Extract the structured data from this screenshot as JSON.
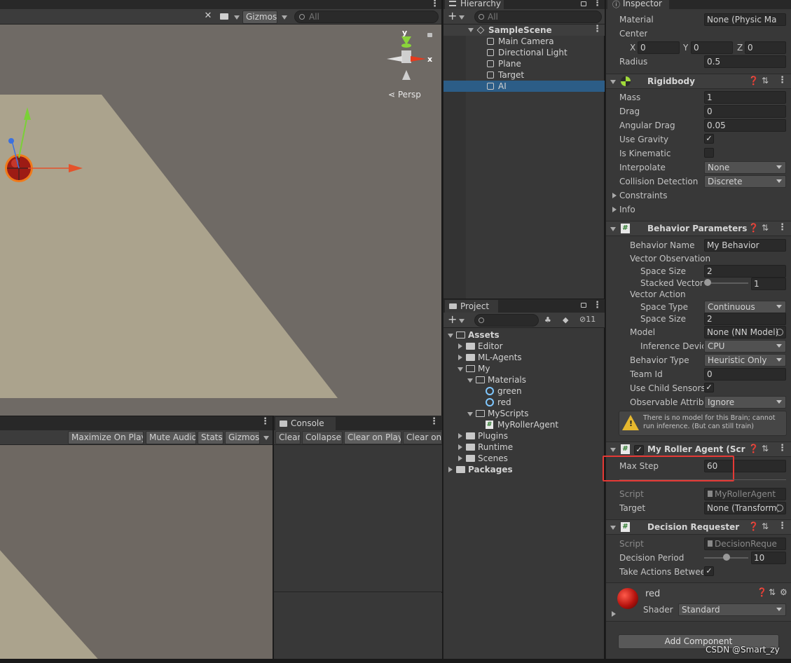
{
  "scene": {
    "toolbar": {
      "gizmos_label": "Gizmos",
      "search_placeholder": "All"
    },
    "gizmo": {
      "y_label": "y",
      "x_label": "x",
      "persp_label": "Persp"
    }
  },
  "game": {
    "toolbar": [
      "Maximize On Play",
      "Mute Audio",
      "Stats",
      "Gizmos"
    ]
  },
  "console": {
    "tab_label": "Console",
    "toolbar": [
      "Clear",
      "Collapse",
      "Clear on Play",
      "Clear on"
    ]
  },
  "hierarchy": {
    "tab_label": "Hierarchy",
    "search_placeholder": "All",
    "scene_name": "SampleScene",
    "items": [
      "Main Camera",
      "Directional Light",
      "Plane",
      "Target",
      "AI"
    ],
    "selected": "AI"
  },
  "project": {
    "tab_label": "Project",
    "hidden_count": "11",
    "tree": [
      {
        "label": "Assets",
        "depth": 0,
        "expanded": true,
        "bold": true,
        "type": "folder"
      },
      {
        "label": "Editor",
        "depth": 1,
        "expanded": false,
        "type": "folder"
      },
      {
        "label": "ML-Agents",
        "depth": 1,
        "expanded": false,
        "type": "folder"
      },
      {
        "label": "My",
        "depth": 1,
        "expanded": true,
        "type": "folder"
      },
      {
        "label": "Materials",
        "depth": 2,
        "expanded": true,
        "type": "folder"
      },
      {
        "label": "green",
        "depth": 3,
        "type": "material"
      },
      {
        "label": "red",
        "depth": 3,
        "type": "material"
      },
      {
        "label": "MyScripts",
        "depth": 2,
        "expanded": true,
        "type": "folder"
      },
      {
        "label": "MyRollerAgent",
        "depth": 3,
        "type": "script"
      },
      {
        "label": "Plugins",
        "depth": 1,
        "expanded": false,
        "type": "folder"
      },
      {
        "label": "Runtime",
        "depth": 1,
        "expanded": false,
        "type": "folder"
      },
      {
        "label": "Scenes",
        "depth": 1,
        "expanded": false,
        "type": "folder"
      },
      {
        "label": "Packages",
        "depth": 0,
        "expanded": false,
        "bold": true,
        "type": "folder"
      }
    ]
  },
  "inspector": {
    "tab_label": "Inspector",
    "collider": {
      "material_label": "Material",
      "material_value": "None (Physic Ma",
      "center_label": "Center",
      "x": "0",
      "y": "0",
      "z": "0",
      "radius_label": "Radius",
      "radius_value": "0.5"
    },
    "rigidbody": {
      "title": "Rigidbody",
      "mass_label": "Mass",
      "mass": "1",
      "drag_label": "Drag",
      "drag": "0",
      "angular_drag_label": "Angular Drag",
      "angular_drag": "0.05",
      "use_gravity_label": "Use Gravity",
      "use_gravity": true,
      "is_kinematic_label": "Is Kinematic",
      "is_kinematic": false,
      "interpolate_label": "Interpolate",
      "interpolate": "None",
      "collision_label": "Collision Detection",
      "collision": "Discrete",
      "constraints_label": "Constraints",
      "info_label": "Info"
    },
    "behavior": {
      "title": "Behavior Parameters",
      "name_label": "Behavior Name",
      "name": "My Behavior",
      "vector_obs_label": "Vector Observation",
      "space_size_label": "Space Size",
      "space_size": "2",
      "stacked_label": "Stacked Vector",
      "stacked": "1",
      "stacked_slider": 0.0,
      "vector_action_label": "Vector Action",
      "space_type_label": "Space Type",
      "space_type": "Continuous",
      "action_size_label": "Space Size",
      "action_size": "2",
      "model_label": "Model",
      "model": "None (NN Model)",
      "inference_label": "Inference Devic",
      "inference": "CPU",
      "behavior_type_label": "Behavior Type",
      "behavior_type": "Heuristic Only",
      "team_label": "Team Id",
      "team": "0",
      "child_sensors_label": "Use Child Sensors",
      "child_sensors": true,
      "observable_label": "Observable Attribu",
      "observable": "Ignore",
      "warning": "There is no model for this Brain; cannot run inference. (But can still train)"
    },
    "agent": {
      "title": "My Roller Agent (Script",
      "max_step_label": "Max Step",
      "max_step": "60",
      "script_label": "Script",
      "script": "MyRollerAgent",
      "target_label": "Target",
      "target": "None (Transform)"
    },
    "decision": {
      "title": "Decision Requester",
      "script_label": "Script",
      "script": "DecisionReque",
      "period_label": "Decision Period",
      "period": "10",
      "period_slider": 0.45,
      "take_actions_label": "Take Actions Betwee",
      "take_actions": true
    },
    "material": {
      "name": "red",
      "shader_label": "Shader",
      "shader": "Standard"
    },
    "add_component": "Add Component"
  },
  "watermark": "CSDN @Smart_zy",
  "colors": {
    "highlight": "#e53935",
    "selection": "#2c5d87",
    "accent_green": "#3cb043"
  }
}
